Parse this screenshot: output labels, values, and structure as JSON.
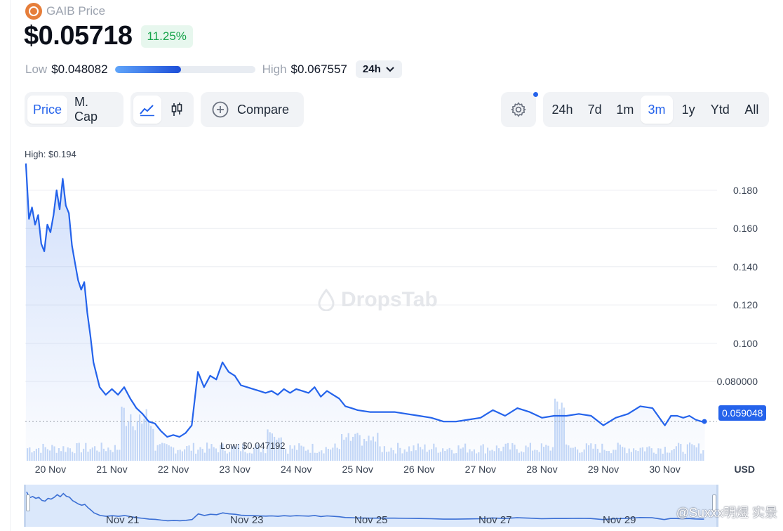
{
  "header": {
    "app_title": "GAIB Price",
    "logo_icon": "gaib-logo-icon"
  },
  "price": {
    "current": "$0.05718",
    "change_pct": "11.25%",
    "low_label": "Low",
    "low_value": "$0.048082",
    "high_label": "High",
    "high_value": "$0.067557",
    "range_position": 0.47,
    "period": "24h"
  },
  "toolbar": {
    "metric_tabs": [
      {
        "label": "Price",
        "active": true
      },
      {
        "label": "M. Cap",
        "active": false
      }
    ],
    "chart_types": [
      {
        "icon": "line-chart-icon",
        "active": true
      },
      {
        "icon": "candlestick-icon",
        "active": false
      }
    ],
    "compare_label": "Compare",
    "settings_icon": "gear-icon",
    "ranges": [
      {
        "label": "24h",
        "active": false
      },
      {
        "label": "7d",
        "active": false
      },
      {
        "label": "1m",
        "active": false
      },
      {
        "label": "3m",
        "active": true
      },
      {
        "label": "1y",
        "active": false
      },
      {
        "label": "Ytd",
        "active": false
      },
      {
        "label": "All",
        "active": false
      }
    ]
  },
  "chart_data": {
    "type": "line",
    "high_label": "High: $0.194",
    "low_label": "Low: $0.047192",
    "watermark": "DropsTab",
    "currency": "USD",
    "current_value_label": "0.059048",
    "current_value": 0.059048,
    "ylim": [
      0.0385,
      0.195
    ],
    "yticks": [
      {
        "value": 0.18,
        "label": "0.180"
      },
      {
        "value": 0.16,
        "label": "0.160"
      },
      {
        "value": 0.14,
        "label": "0.140"
      },
      {
        "value": 0.12,
        "label": "0.120"
      },
      {
        "value": 0.1,
        "label": "0.100"
      },
      {
        "value": 0.08,
        "label": "0.080000"
      }
    ],
    "xlim": [
      19.59,
      30.85
    ],
    "xticks": [
      {
        "value": 20,
        "label": "20 Nov"
      },
      {
        "value": 21,
        "label": "21 Nov"
      },
      {
        "value": 22,
        "label": "22 Nov"
      },
      {
        "value": 23,
        "label": "23 Nov"
      },
      {
        "value": 24,
        "label": "24 Nov"
      },
      {
        "value": 25,
        "label": "25 Nov"
      },
      {
        "value": 26,
        "label": "26 Nov"
      },
      {
        "value": 27,
        "label": "27 Nov"
      },
      {
        "value": 28,
        "label": "28 Nov"
      },
      {
        "value": 29,
        "label": "29 Nov"
      },
      {
        "value": 30,
        "label": "30 Nov"
      }
    ],
    "series": [
      {
        "x": [
          19.6,
          19.65,
          19.7,
          19.75,
          19.8,
          19.85,
          19.9,
          19.95,
          20.0,
          20.05,
          20.1,
          20.15,
          20.2,
          20.25,
          20.3,
          20.35,
          20.4,
          20.45,
          20.5,
          20.55,
          20.6,
          20.65,
          20.7,
          20.8,
          20.9,
          21.0,
          21.1,
          21.2,
          21.3,
          21.4,
          21.5,
          21.6,
          21.7,
          21.8,
          21.9,
          22.0,
          22.1,
          22.2,
          22.3,
          22.4,
          22.5,
          22.6,
          22.7,
          22.8,
          22.9,
          23.0,
          23.1,
          23.2,
          23.3,
          23.4,
          23.5,
          23.6,
          23.7,
          23.8,
          23.9,
          23.95,
          24.0,
          24.1,
          24.2,
          24.3,
          24.4,
          24.5,
          24.6,
          24.7,
          24.8,
          24.9,
          25.0,
          25.2,
          25.4,
          25.6,
          25.8,
          26.0,
          26.2,
          26.4,
          26.6,
          26.8,
          27.0,
          27.2,
          27.4,
          27.6,
          27.8,
          28.0,
          28.2,
          28.4,
          28.6,
          28.8,
          29.0,
          29.2,
          29.4,
          29.6,
          29.8,
          30.0,
          30.1,
          30.2,
          30.3,
          30.4,
          30.5,
          30.6,
          30.65
        ],
        "values": [
          0.194,
          0.165,
          0.171,
          0.162,
          0.167,
          0.152,
          0.148,
          0.162,
          0.158,
          0.167,
          0.18,
          0.17,
          0.186,
          0.172,
          0.168,
          0.151,
          0.142,
          0.133,
          0.128,
          0.132,
          0.116,
          0.104,
          0.09,
          0.077,
          0.073,
          0.076,
          0.073,
          0.077,
          0.071,
          0.066,
          0.063,
          0.059,
          0.058,
          0.054,
          0.051,
          0.052,
          0.051,
          0.053,
          0.057,
          0.085,
          0.077,
          0.083,
          0.081,
          0.09,
          0.085,
          0.083,
          0.078,
          0.077,
          0.076,
          0.075,
          0.074,
          0.075,
          0.073,
          0.076,
          0.074,
          0.075,
          0.076,
          0.075,
          0.074,
          0.077,
          0.072,
          0.075,
          0.073,
          0.071,
          0.067,
          0.066,
          0.065,
          0.064,
          0.064,
          0.064,
          0.063,
          0.062,
          0.061,
          0.059,
          0.059,
          0.06,
          0.061,
          0.065,
          0.062,
          0.066,
          0.064,
          0.061,
          0.062,
          0.062,
          0.063,
          0.062,
          0.057,
          0.061,
          0.063,
          0.067,
          0.066,
          0.057,
          0.062,
          0.062,
          0.061,
          0.062,
          0.06,
          0.059,
          0.059
        ]
      }
    ]
  },
  "navigator": {
    "ticks": [
      "Nov 21",
      "Nov 23",
      "Nov 25",
      "Nov 27",
      "Nov 29"
    ],
    "stamp": "@Suxxx明煜 实景"
  }
}
